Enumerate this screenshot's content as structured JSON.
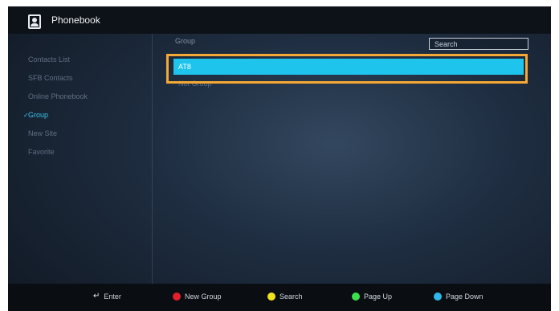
{
  "app": {
    "title": "Phonebook"
  },
  "sidebar": {
    "items": [
      {
        "label": "Contacts List"
      },
      {
        "label": "SFB Contacts"
      },
      {
        "label": "Online Phonebook"
      },
      {
        "label": "Group"
      },
      {
        "label": "New Site"
      },
      {
        "label": "Favorite"
      }
    ],
    "active_index": 3
  },
  "main": {
    "header": "Group",
    "search": {
      "placeholder": "Search"
    },
    "rows": [
      {
        "label": "AT8"
      },
      {
        "label": "Not Group"
      }
    ]
  },
  "footer": {
    "hints": [
      {
        "label": "Enter",
        "icon": "enter-icon"
      },
      {
        "label": "New Group",
        "color": "#e0202c"
      },
      {
        "label": "Search",
        "color": "#f0e21c"
      },
      {
        "label": "Page Up",
        "color": "#3ce04a"
      },
      {
        "label": "Page Down",
        "color": "#2fb7ea"
      }
    ]
  },
  "colors": {
    "accent": "#1ec4ec",
    "highlight_frame": "#f4a835",
    "active_text": "#37c4ea"
  }
}
